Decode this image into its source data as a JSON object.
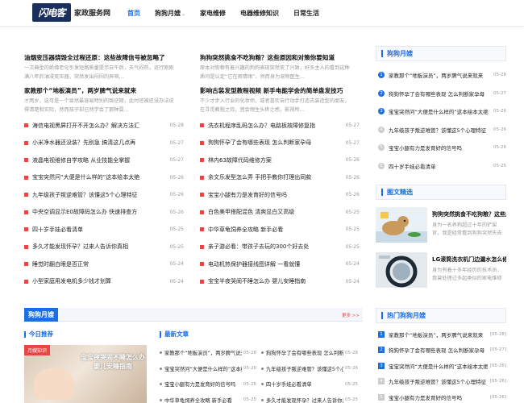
{
  "header": {
    "logo_mark": "闪电客",
    "logo_text": "家政服务网",
    "nav": [
      {
        "label": "首页",
        "active": true
      },
      {
        "label": "狗狗月嫂",
        "has_dropdown": true
      },
      {
        "label": "家电维修"
      },
      {
        "label": "电器维修知识"
      },
      {
        "label": "日常生活"
      }
    ]
  },
  "featured": [
    {
      "title": "油烟变压器烧毁全过程还原：这些故障信号被忽略了",
      "desc": "一次典型的绝缘老化引发短路质量提示日午后，天气闷热，运行刚刚满八年的油浸变压器，突然发出闷闷的异响..."
    },
    {
      "title": "狗狗突然挑食不吃狗粮？这些原因和对策你要知道",
      "desc": "原本对狗粮有着兴趣的狗狗表现突然变了兴致，好多主人的看到这种质问是认定“它在闹情绪”，然而身为宠物医生..."
    },
    {
      "title": "家教那个“地板演员”，两岁脾气说来就来",
      "desc": "才两岁，这可是一个显然最容易特别的叛逆期，此时还被还没办法说得清楚和实际，然而孩子却已然学会了那种耍..."
    },
    {
      "title": "影响古装发型教程视频 新手电能学会的简单盘发技巧",
      "desc": "不少才步入行业的化妆师，或者喜欢自行动手打造古装造型的朋友，在寻觅教程之际，皆会频生头疼之感，影视所..."
    }
  ],
  "list_left": [
    {
      "title": "海信电视黑屏打开不开怎么办？解决方法汇",
      "date": "05-28"
    },
    {
      "title": "小米净水器还没装？先别急 搞清这几点再",
      "date": "05-27"
    },
    {
      "title": "液晶电视维修自学攻略 从业技能全掌握",
      "date": "05-27"
    },
    {
      "title": "宝宝突然问“大便是什么样的”这本绘本太绝",
      "date": "05-26"
    },
    {
      "title": "九年级孩子叛逆难管？该懂这5个心理特征",
      "date": "05-26"
    },
    {
      "title": "中央空调显示E0故障码怎么办 快速排查方",
      "date": "05-26"
    },
    {
      "title": "四十岁手娃必看清单",
      "date": "05-25"
    },
    {
      "title": "多久才能发现怀孕？过来人告诉你真相",
      "date": "05-25"
    },
    {
      "title": "睡觉时翻白眼是否正常",
      "date": "05-24"
    },
    {
      "title": "小型家庭用发电机多少钱才划算",
      "date": "05-24"
    }
  ],
  "list_right": [
    {
      "title": "洗衣机程序乱码怎么办？电路板故障修复指",
      "date": "05-27"
    },
    {
      "title": "狗狗怀孕了会有哪些表现 怎么判断家孕母",
      "date": "05-27"
    },
    {
      "title": "林内63故障代码维修方案",
      "date": "05-26"
    },
    {
      "title": "余文乐发型怎么弄 手把手教你打理出同款",
      "date": "05-26"
    },
    {
      "title": "宝宝小腿有力是发育好的信号吗",
      "date": "05-26"
    },
    {
      "title": "白色美甲搭配混色 清爽显白又高级",
      "date": "05-25"
    },
    {
      "title": "中华草龟饲养全攻略 新手必看",
      "date": "05-25"
    },
    {
      "title": "亲子游必看：带孩子去玩的300个好去处",
      "date": "05-25"
    },
    {
      "title": "电动机热保护器接线图详解 一看就懂",
      "date": "05-24"
    },
    {
      "title": "宝宝半夜哭闹不睡怎么办 婴儿安睡指南",
      "date": "05-24"
    }
  ],
  "section": {
    "tag": "狗狗月嫂",
    "more": "更多 >>",
    "today_label": "今日推荐",
    "latest_label": "最新文章",
    "rec": {
      "tag": "月嫂知识",
      "caption": "宝宝夜哭闹不睡怎么办 婴儿安睡指南"
    },
    "latest": [
      [
        {
          "title": "家教那个“地板演员”，两岁脾气说来就来",
          "date": "05-28"
        },
        {
          "title": "狗狗怀孕了会有哪些表现 怎么判断家孕母",
          "date": "05-28"
        }
      ],
      [
        {
          "title": "宝宝突然问“大便是什么样的”这本绘本太绝",
          "date": "05-26"
        },
        {
          "title": "九年级孩子叛逆难管？该懂这5个心理特征",
          "date": "05-26"
        }
      ],
      [
        {
          "title": "宝宝小腿有力是发育好的信号吗",
          "date": "05-26"
        },
        {
          "title": "四十岁手娃必看清单",
          "date": "05-25"
        }
      ],
      [
        {
          "title": "中华草龟饲养全攻略 新手必看",
          "date": "05-25"
        },
        {
          "title": "多久才能发现怀孕？过来人告诉你真相",
          "date": "05-25"
        }
      ]
    ]
  },
  "sidebar": {
    "hot_title": "狗狗月嫂",
    "hot": [
      {
        "n": "1",
        "title": "家教那个“地板演员”，两岁脾气说来就来",
        "date": "05-28"
      },
      {
        "n": "2",
        "title": "狗狗怀孕了会有哪些表现 怎么判断家孕母",
        "date": "05-27"
      },
      {
        "n": "3",
        "title": "宝宝突然问“大便是什么样的”这本绘本太绝",
        "date": "05-26"
      },
      {
        "n": "4",
        "title": "九年级孩子叛逆难管？该懂这5个心理特征",
        "date": "05-26"
      },
      {
        "n": "5",
        "title": "宝宝小腿有力是发育好的信号吗",
        "date": "05-26"
      },
      {
        "n": "6",
        "title": "四十岁手娃必看清单",
        "date": "05-25"
      }
    ],
    "pics_title": "图文精选",
    "pics": [
      {
        "title": "狗狗突然挑食不吃狗粮？这些原因和对策你要知道",
        "desc": "身为一名养狗超过十年的铲屎官，我是经常看到狗狗突然失去胃口"
      },
      {
        "title": "LG滚筒洗衣机门边漏水怎么修",
        "desc": "身为有着十多年经历的技术员，我曾处理过多起类似的家电维修问题"
      }
    ],
    "hot2_title": "热门狗狗月嫂",
    "hot2": [
      {
        "n": "1",
        "title": "家教那个“地板演员”，两岁脾气说来就来",
        "date": "[05-28]"
      },
      {
        "n": "2",
        "title": "狗狗怀孕了会有哪些表现 怎么判断家孕母",
        "date": "[05-27]"
      },
      {
        "n": "3",
        "title": "宝宝突然问“大便是什么样的”这本绘本太绝",
        "date": "[05-26]"
      },
      {
        "n": "4",
        "title": "九年级孩子叛逆难管？该懂这5个心理特征",
        "date": "[05-26]"
      },
      {
        "n": "5",
        "title": "宝宝小腿有力是发育好的信号吗",
        "date": "[05-26]"
      }
    ]
  },
  "colors": {
    "accent": "#1a6ee6",
    "red": "#e84545"
  }
}
